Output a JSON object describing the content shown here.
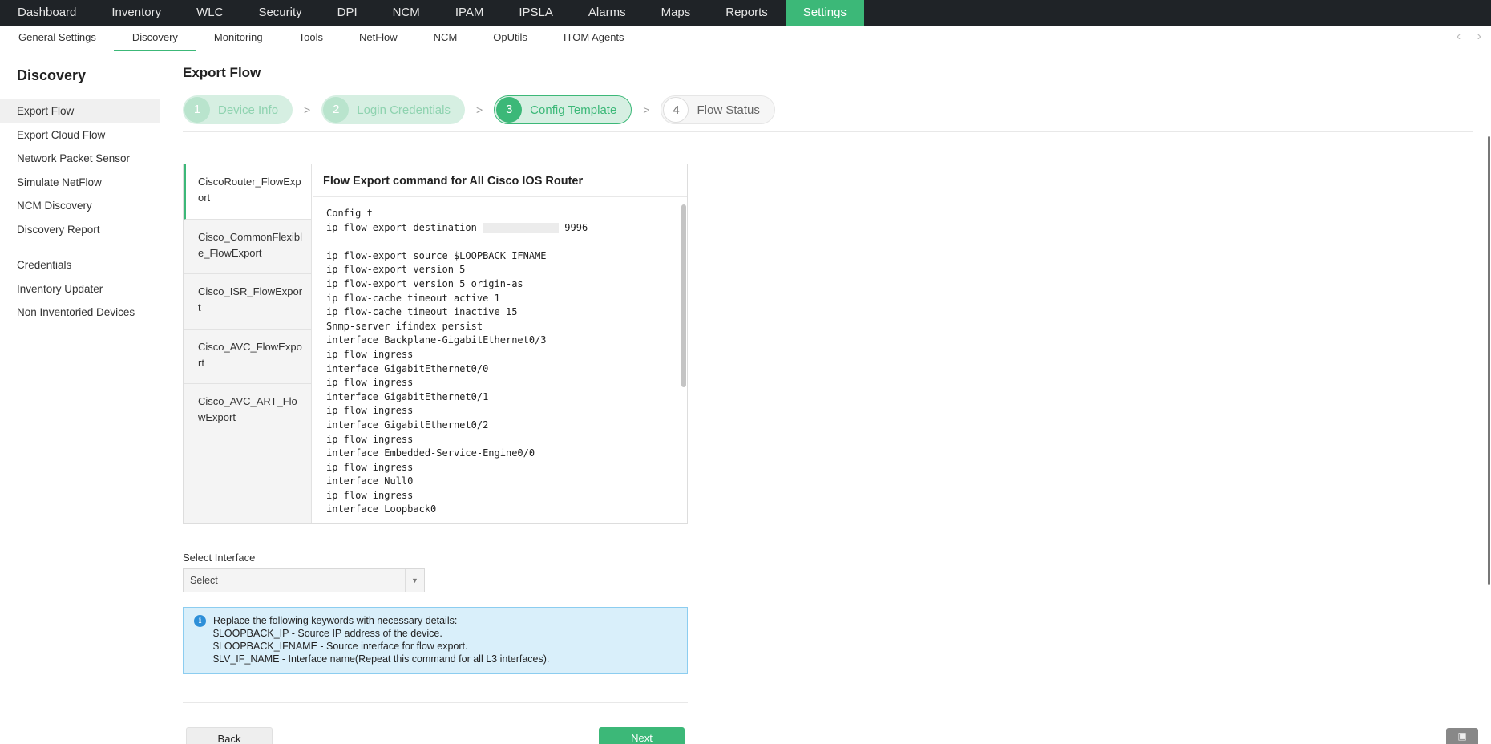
{
  "topnav": {
    "items": [
      "Dashboard",
      "Inventory",
      "WLC",
      "Security",
      "DPI",
      "NCM",
      "IPAM",
      "IPSLA",
      "Alarms",
      "Maps",
      "Reports",
      "Settings"
    ],
    "active": "Settings"
  },
  "subnav": {
    "items": [
      "General Settings",
      "Discovery",
      "Monitoring",
      "Tools",
      "NetFlow",
      "NCM",
      "OpUtils",
      "ITOM Agents"
    ],
    "active": "Discovery",
    "arrows": "‹ ›"
  },
  "sidebar": {
    "title": "Discovery",
    "items": [
      "Export Flow",
      "Export Cloud Flow",
      "Network Packet Sensor",
      "Simulate NetFlow",
      "NCM Discovery",
      "Discovery Report"
    ],
    "items2": [
      "Credentials",
      "Inventory Updater",
      "Non Inventoried Devices"
    ]
  },
  "main": {
    "title": "Export Flow",
    "steps": [
      {
        "num": "1",
        "label": "Device Info",
        "state": "done"
      },
      {
        "num": "2",
        "label": "Login Credentials",
        "state": "done"
      },
      {
        "num": "3",
        "label": "Config Template",
        "state": "current"
      },
      {
        "num": "4",
        "label": "Flow Status",
        "state": "pending"
      }
    ],
    "step_separator": ">",
    "templates": [
      "CiscoRouter_FlowExport",
      "Cisco_CommonFlexible_FlowExport",
      "Cisco_ISR_FlowExport",
      "Cisco_AVC_FlowExport",
      "Cisco_AVC_ART_FlowExport"
    ],
    "active_template": "CiscoRouter_FlowExport",
    "content_title": "Flow Export command for All Cisco IOS Router",
    "code_lines": [
      "Config t",
      "ip flow-export destination ",
      "",
      "ip flow-export source $LOOPBACK_IFNAME",
      "ip flow-export version 5",
      "ip flow-export version 5 origin-as",
      "ip flow-cache timeout active 1",
      "ip flow-cache timeout inactive 15",
      "Snmp-server ifindex persist",
      "interface Backplane-GigabitEthernet0/3",
      "ip flow ingress",
      "interface GigabitEthernet0/0",
      "ip flow ingress",
      "interface GigabitEthernet0/1",
      "ip flow ingress",
      "interface GigabitEthernet0/2",
      "ip flow ingress",
      "interface Embedded-Service-Engine0/0",
      "ip flow ingress",
      "interface Null0",
      "ip flow ingress",
      "interface Loopback0"
    ],
    "destination_port": " 9996",
    "select_label": "Select Interface",
    "select_value": "Select",
    "info_lines": [
      "Replace the following keywords with necessary details:",
      "$LOOPBACK_IP - Source IP address of the device.",
      "$LOOPBACK_IFNAME - Source interface for flow export.",
      "$LV_IF_NAME - Interface name(Repeat this command for all L3 interfaces)."
    ],
    "info_icon": "i",
    "back_label": "Back",
    "next_label": "Next"
  },
  "colors": {
    "accent": "#3cb878",
    "topbar": "#1f2327",
    "info_bg": "#d9effa",
    "info_border": "#8ccdf0"
  }
}
